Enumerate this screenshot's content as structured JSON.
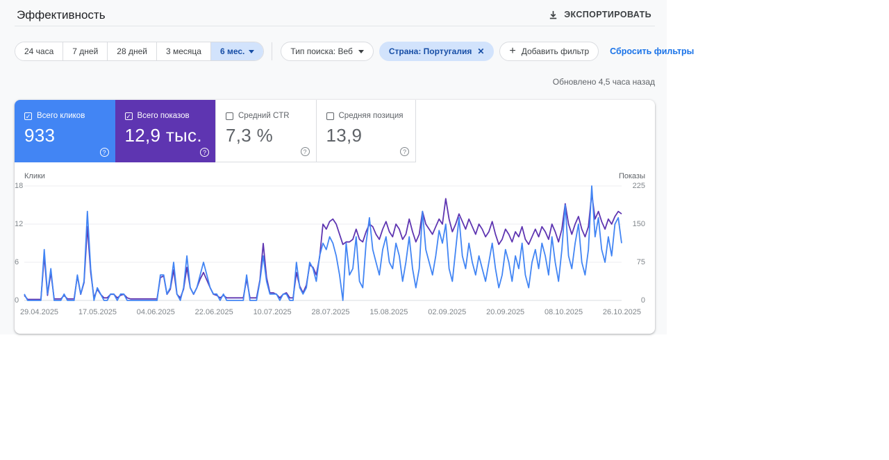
{
  "page": {
    "title": "Эффективность",
    "updated": "Обновлено 4,5 часа назад"
  },
  "toolbar": {
    "export_label": "ЭКСПОРТИРОВАТЬ"
  },
  "filters": {
    "date_ranges": [
      "24 часа",
      "7 дней",
      "28 дней",
      "3 месяца",
      "6 мес."
    ],
    "selected_range": "6 мес.",
    "search_type": "Тип поиска: Веб",
    "country_chip": "Страна: Португалия",
    "add_filter": "Добавить фильтр",
    "reset_filters": "Сбросить фильтры"
  },
  "metrics": [
    {
      "label": "Всего кликов",
      "value": "933",
      "checked": true,
      "color": "#4285f4"
    },
    {
      "label": "Всего показов",
      "value": "12,9 тыс.",
      "checked": true,
      "color": "#5e35b1"
    },
    {
      "label": "Средний CTR",
      "value": "7,3 %",
      "checked": false,
      "color": "#ffffff"
    },
    {
      "label": "Средняя позиция",
      "value": "13,9",
      "checked": false,
      "color": "#ffffff"
    }
  ],
  "chart_data": {
    "type": "line",
    "x_range": "29.04.2025 – 26.10.2025 (daily points)",
    "x_tick_labels": [
      "29.04.2025",
      "17.05.2025",
      "04.06.2025",
      "22.06.2025",
      "10.07.2025",
      "28.07.2025",
      "15.08.2025",
      "02.09.2025",
      "20.09.2025",
      "08.10.2025",
      "26.10.2025"
    ],
    "left_axis": {
      "label": "Клики",
      "ticks": [
        0,
        6,
        12,
        18
      ],
      "max": 18
    },
    "right_axis": {
      "label": "Показы",
      "ticks": [
        0,
        75,
        150,
        225
      ],
      "max": 225
    },
    "grid": true,
    "legend_position": "none",
    "series": [
      {
        "name": "Показы",
        "axis": "right",
        "color": "#5e35b1",
        "values": [
          10,
          2,
          2,
          2,
          2,
          2,
          88,
          10,
          55,
          3,
          3,
          3,
          10,
          3,
          3,
          3,
          48,
          12,
          35,
          145,
          55,
          5,
          22,
          12,
          5,
          5,
          12,
          12,
          5,
          10,
          12,
          5,
          3,
          3,
          3,
          3,
          3,
          3,
          3,
          3,
          3,
          45,
          48,
          12,
          22,
          60,
          12,
          5,
          22,
          65,
          25,
          12,
          25,
          42,
          55,
          40,
          25,
          12,
          10,
          5,
          10,
          5,
          5,
          5,
          5,
          5,
          5,
          42,
          5,
          5,
          5,
          40,
          112,
          45,
          15,
          15,
          12,
          5,
          12,
          15,
          5,
          5,
          55,
          28,
          15,
          30,
          70,
          65,
          50,
          85,
          150,
          140,
          155,
          160,
          150,
          130,
          110,
          115,
          115,
          120,
          140,
          120,
          115,
          135,
          150,
          145,
          130,
          120,
          140,
          155,
          135,
          125,
          150,
          140,
          120,
          130,
          160,
          135,
          115,
          130,
          175,
          150,
          140,
          130,
          145,
          160,
          150,
          200,
          160,
          135,
          150,
          170,
          155,
          140,
          160,
          145,
          130,
          150,
          140,
          125,
          135,
          155,
          130,
          110,
          120,
          140,
          130,
          115,
          135,
          125,
          145,
          120,
          110,
          125,
          140,
          125,
          145,
          135,
          120,
          150,
          135,
          115,
          140,
          190,
          150,
          130,
          150,
          165,
          140,
          125,
          145,
          210,
          160,
          175,
          155,
          140,
          160,
          150,
          165,
          175,
          170
        ]
      },
      {
        "name": "Клики",
        "axis": "left",
        "color": "#4285f4",
        "values": [
          1,
          0,
          0,
          0,
          0,
          0,
          8,
          1,
          5,
          0,
          0,
          0,
          1,
          0,
          0,
          0,
          4,
          1,
          3,
          14,
          5,
          0,
          2,
          1,
          0,
          0,
          1,
          1,
          0,
          1,
          1,
          0,
          0,
          0,
          0,
          0,
          0,
          0,
          0,
          0,
          0,
          4,
          4,
          1,
          2,
          6,
          1,
          0,
          2,
          7,
          2,
          1,
          2,
          4,
          6,
          4,
          2,
          1,
          1,
          0,
          1,
          0,
          0,
          0,
          0,
          0,
          0,
          4,
          0,
          0,
          0,
          3,
          7,
          3,
          1,
          1,
          1,
          0,
          1,
          1,
          0,
          0,
          6,
          2,
          1,
          2,
          6,
          5,
          3,
          7,
          9,
          8,
          10,
          9,
          7,
          4,
          0,
          9,
          4,
          5,
          10,
          3,
          2,
          9,
          13,
          8,
          6,
          4,
          8,
          10,
          6,
          5,
          9,
          7,
          3,
          6,
          10,
          5,
          2,
          5,
          14,
          8,
          6,
          4,
          7,
          11,
          9,
          12,
          5,
          3,
          8,
          13,
          7,
          5,
          9,
          6,
          4,
          7,
          5,
          3,
          6,
          9,
          5,
          2,
          4,
          8,
          6,
          3,
          7,
          5,
          9,
          4,
          2,
          6,
          8,
          5,
          9,
          7,
          4,
          10,
          6,
          3,
          8,
          15,
          7,
          5,
          9,
          12,
          6,
          4,
          8,
          18,
          10,
          13,
          8,
          6,
          10,
          7,
          12,
          13,
          9
        ]
      }
    ]
  }
}
